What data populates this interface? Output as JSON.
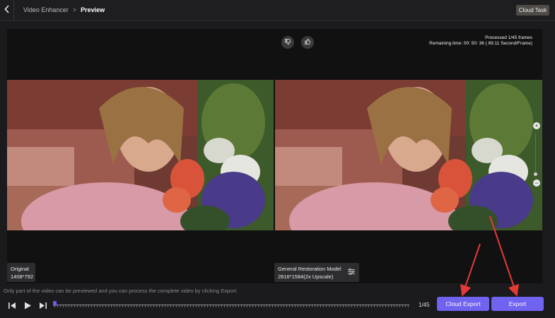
{
  "header": {
    "back_icon": "chevron-left-icon",
    "breadcrumb_parent": "Video Enhancer",
    "breadcrumb_separator": ">",
    "breadcrumb_current": "Preview",
    "cloud_task_label": "Cloud Task"
  },
  "preview": {
    "dislike_icon": "thumbs-down-icon",
    "like_icon": "thumbs-up-icon",
    "processed_text": "Processed 1/45 frames",
    "remaining_text": "Remaining time: 00: 50: 36 ( 69.11 Second/Frame)",
    "original_label": "Original",
    "original_resolution": "1408*792",
    "model_label": "General Restoration Model",
    "model_resolution": "2816*1584(2x Upscale)",
    "zoom_in_symbol": "+",
    "zoom_out_symbol": "−"
  },
  "footer": {
    "hint": "Only part of the video can be previewed and you can process the complete video by clicking Export.",
    "frame_counter": "1/45",
    "cloud_export_label": "Cloud Export",
    "export_label": "Export"
  },
  "colors": {
    "accent": "#6f63ef",
    "annotation_arrow": "#e53935",
    "background": "#1b1b1d"
  }
}
